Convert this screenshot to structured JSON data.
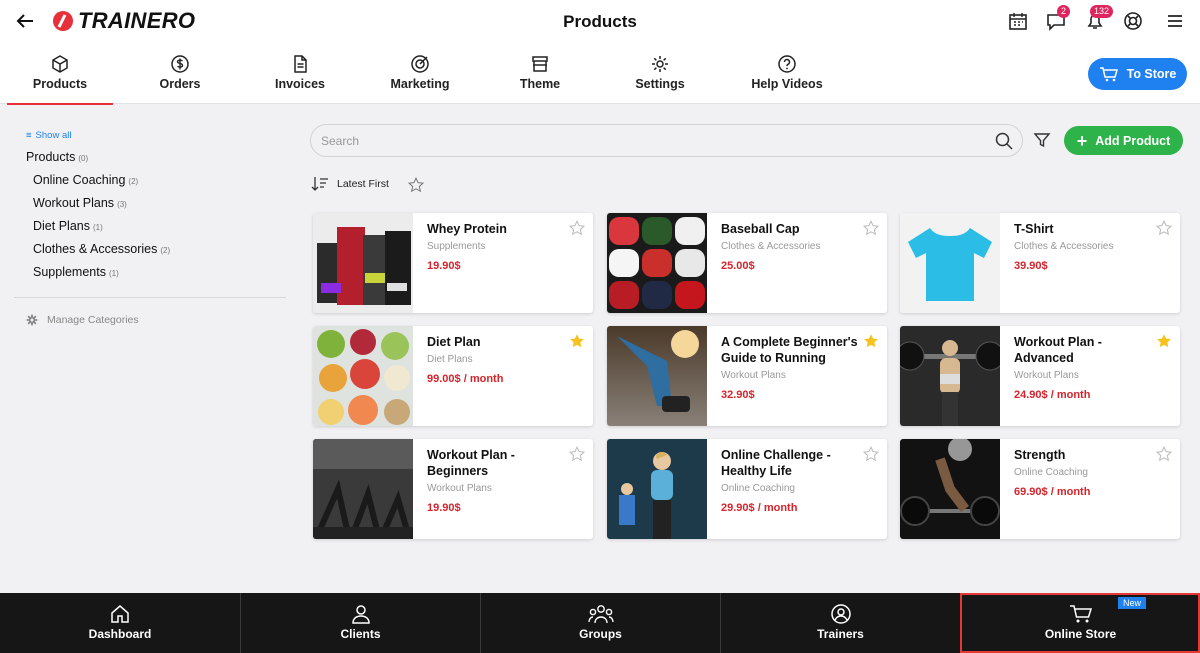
{
  "header": {
    "logo_text": "TRAINERO",
    "title": "Products",
    "messages_badge": "2",
    "notifications_badge": "132"
  },
  "tabs": [
    {
      "label": "Products",
      "icon": "box-icon",
      "active": true
    },
    {
      "label": "Orders",
      "icon": "dollar-icon"
    },
    {
      "label": "Invoices",
      "icon": "document-icon"
    },
    {
      "label": "Marketing",
      "icon": "target-icon"
    },
    {
      "label": "Theme",
      "icon": "storefront-icon"
    },
    {
      "label": "Settings",
      "icon": "gear-icon"
    },
    {
      "label": "Help Videos",
      "icon": "question-icon"
    }
  ],
  "to_store_label": "To Store",
  "sidebar": {
    "show_all": "Show all",
    "root": {
      "label": "Products",
      "count": "(0)"
    },
    "items": [
      {
        "label": "Online Coaching",
        "count": "(2)"
      },
      {
        "label": "Workout Plans",
        "count": "(3)"
      },
      {
        "label": "Diet Plans",
        "count": "(1)"
      },
      {
        "label": "Clothes & Accessories",
        "count": "(2)"
      },
      {
        "label": "Supplements",
        "count": "(1)"
      }
    ],
    "manage": "Manage Categories"
  },
  "search": {
    "placeholder": "Search"
  },
  "add_product_label": "Add Product",
  "sort_label": "Latest First",
  "products": [
    {
      "name": "Whey Protein",
      "category": "Supplements",
      "price": "19.90$",
      "starred": false
    },
    {
      "name": "Baseball Cap",
      "category": "Clothes & Accessories",
      "price": "25.00$",
      "starred": false
    },
    {
      "name": "T-Shirt",
      "category": "Clothes & Accessories",
      "price": "39.90$",
      "starred": false
    },
    {
      "name": "Diet Plan",
      "category": "Diet Plans",
      "price": "99.00$ / month",
      "starred": true
    },
    {
      "name": "A Complete Beginner's Guide to Running",
      "category": "Workout Plans",
      "price": "32.90$",
      "starred": true
    },
    {
      "name": "Workout Plan - Advanced",
      "category": "Workout Plans",
      "price": "24.90$ / month",
      "starred": true
    },
    {
      "name": "Workout Plan - Beginners",
      "category": "Workout Plans",
      "price": "19.90$",
      "starred": false
    },
    {
      "name": "Online Challenge - Healthy Life",
      "category": "Online Coaching",
      "price": "29.90$ / month",
      "starred": false
    },
    {
      "name": "Strength",
      "category": "Online Coaching",
      "price": "69.90$ / month",
      "starred": false
    }
  ],
  "bottom_nav": [
    {
      "label": "Dashboard",
      "icon": "home-icon"
    },
    {
      "label": "Clients",
      "icon": "person-icon"
    },
    {
      "label": "Groups",
      "icon": "group-icon"
    },
    {
      "label": "Trainers",
      "icon": "user-circle-icon"
    },
    {
      "label": "Online Store",
      "icon": "cart-icon",
      "badge": "New"
    }
  ],
  "colors": {
    "accent": "#e8303a",
    "primary": "#1f80f0",
    "add": "#2db34a",
    "price": "#d5242c",
    "star": "#f7c21d"
  }
}
